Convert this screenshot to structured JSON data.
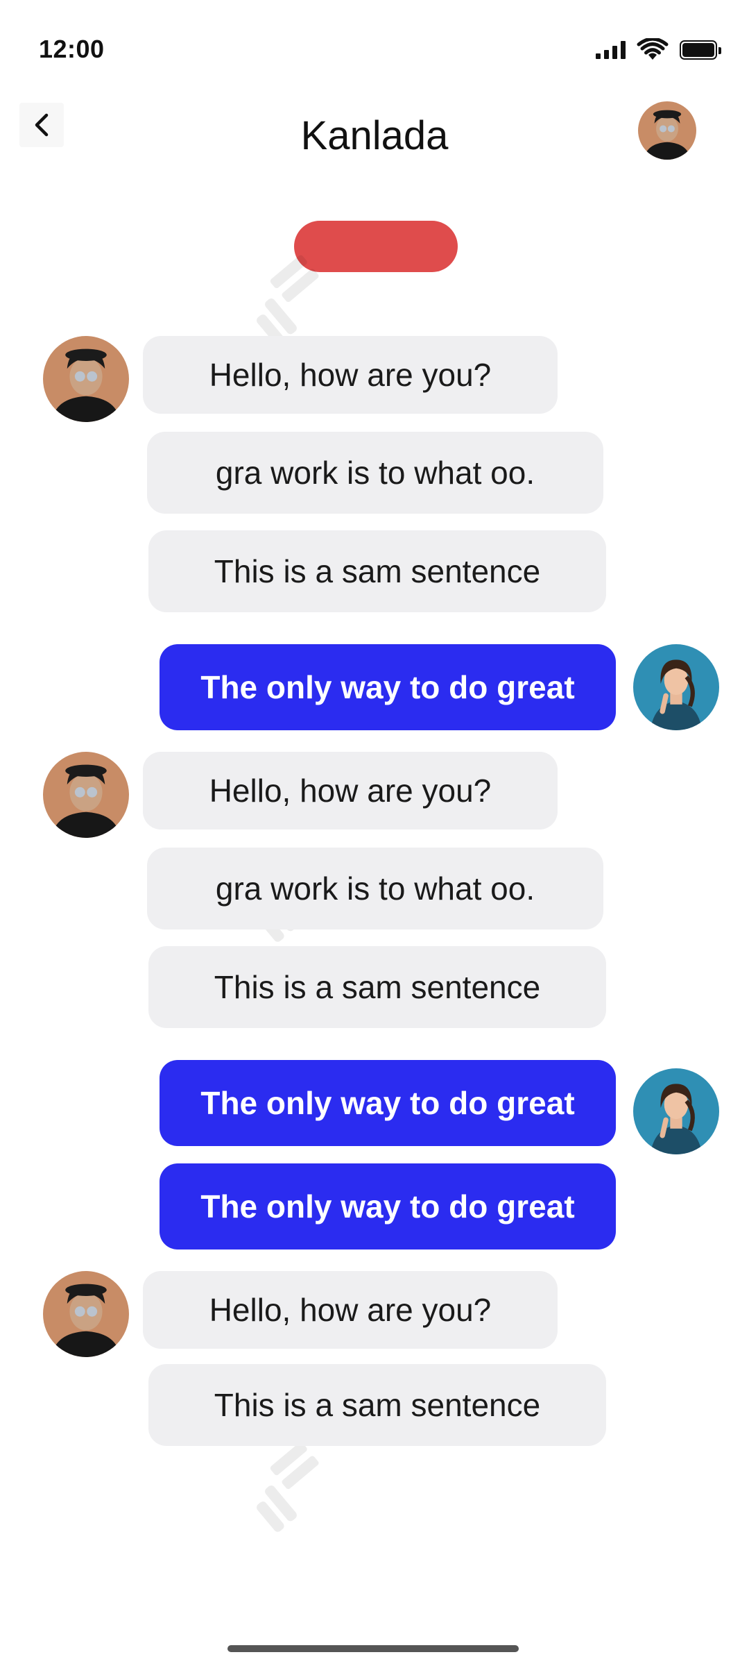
{
  "status_bar": {
    "time": "12:00"
  },
  "header": {
    "title": "Kanlada",
    "back_icon": "chevron-left-icon"
  },
  "colors": {
    "incoming_bubble": "#efeff1",
    "outgoing_bubble": "#2b2cf0",
    "status_pill": "#df4c4c"
  },
  "messages": [
    {
      "sender": "contact",
      "text": "Hello, how are you?"
    },
    {
      "sender": "contact",
      "text": "gra work is to what oo."
    },
    {
      "sender": "contact",
      "text": "This is a sam sentence"
    },
    {
      "sender": "me",
      "text": "The only way to do great"
    },
    {
      "sender": "contact",
      "text": "Hello, how are you?"
    },
    {
      "sender": "contact",
      "text": "gra work is to what oo."
    },
    {
      "sender": "contact",
      "text": "This is a sam sentence"
    },
    {
      "sender": "me",
      "text": "The only way to do great"
    },
    {
      "sender": "me",
      "text": "The only way to do great"
    },
    {
      "sender": "contact",
      "text": "Hello, how are you?"
    },
    {
      "sender": "contact",
      "text": "This is a sam sentence"
    }
  ]
}
